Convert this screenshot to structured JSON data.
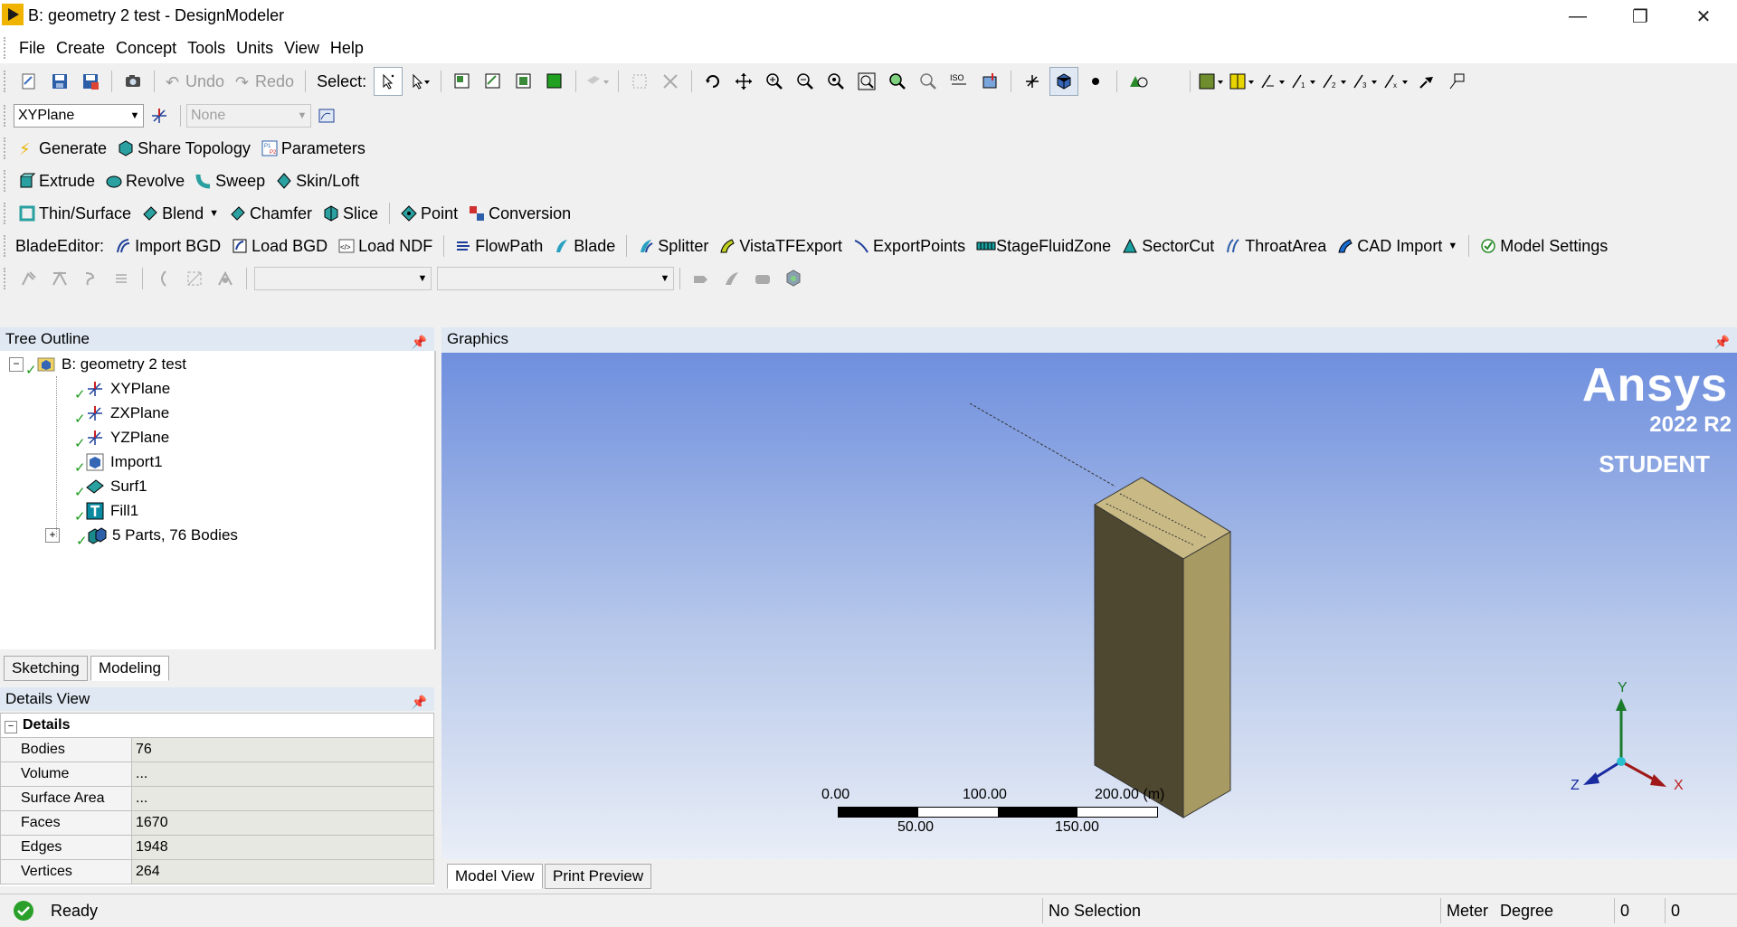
{
  "window": {
    "title": "B: geometry 2 test - DesignModeler"
  },
  "menu": [
    "File",
    "Create",
    "Concept",
    "Tools",
    "Units",
    "View",
    "Help"
  ],
  "toolbar_main": {
    "undo": "Undo",
    "redo": "Redo",
    "select_label": "Select:"
  },
  "toolbar_plane": {
    "plane_value": "XYPlane",
    "sketch_value": "None"
  },
  "toolbar_generate": {
    "generate": "Generate",
    "share_topology": "Share Topology",
    "parameters": "Parameters"
  },
  "toolbar_features": {
    "extrude": "Extrude",
    "revolve": "Revolve",
    "sweep": "Sweep",
    "skin_loft": "Skin/Loft"
  },
  "toolbar_features2": {
    "thin_surface": "Thin/Surface",
    "blend": "Blend",
    "chamfer": "Chamfer",
    "slice": "Slice",
    "point": "Point",
    "conversion": "Conversion"
  },
  "toolbar_blade": {
    "label": "BladeEditor:",
    "import_bgd": "Import BGD",
    "load_bgd": "Load BGD",
    "load_ndf": "Load NDF",
    "flowpath": "FlowPath",
    "blade": "Blade",
    "splitter": "Splitter",
    "vistatfexport": "VistaTFExport",
    "exportpoints": "ExportPoints",
    "stagefluidzone": "StageFluidZone",
    "sectorcut": "SectorCut",
    "throatarea": "ThroatArea",
    "cad_import": "CAD Import",
    "model_settings": "Model Settings"
  },
  "tree": {
    "header": "Tree Outline",
    "root": "B: geometry 2 test",
    "items": [
      "XYPlane",
      "ZXPlane",
      "YZPlane",
      "Import1",
      "Surf1",
      "Fill1",
      "5 Parts, 76 Bodies"
    ]
  },
  "tabs_left": {
    "sketching": "Sketching",
    "modeling": "Modeling"
  },
  "details": {
    "header": "Details View",
    "section": "Details",
    "rows": [
      {
        "label": "Bodies",
        "value": "76"
      },
      {
        "label": "Volume",
        "value": "..."
      },
      {
        "label": "Surface Area",
        "value": "..."
      },
      {
        "label": "Faces",
        "value": "1670"
      },
      {
        "label": "Edges",
        "value": "1948"
      },
      {
        "label": "Vertices",
        "value": "264"
      }
    ]
  },
  "graphics": {
    "header": "Graphics",
    "brand": "Ansys",
    "version": "2022 R2",
    "edition": "STUDENT",
    "scale": {
      "top_labels": [
        "0.00",
        "100.00",
        "200.00 (m)"
      ],
      "bottom_labels": [
        "50.00",
        "150.00"
      ]
    },
    "triad": {
      "x": "X",
      "y": "Y",
      "z": "Z"
    },
    "tabs": {
      "model_view": "Model View",
      "print_preview": "Print Preview"
    }
  },
  "status": {
    "state": "Ready",
    "selection": "No Selection",
    "length_unit": "Meter",
    "angle_unit": "Degree",
    "field1": "0",
    "field2": "0"
  },
  "colors": {
    "accent": "#dfe8f3",
    "viewport_top": "#6f8fde",
    "viewport_bottom": "#e9eef7",
    "body_front": "#4f4830",
    "body_side": "#a89a63",
    "body_top": "#c8b985",
    "check_green": "#1a9a1a"
  }
}
